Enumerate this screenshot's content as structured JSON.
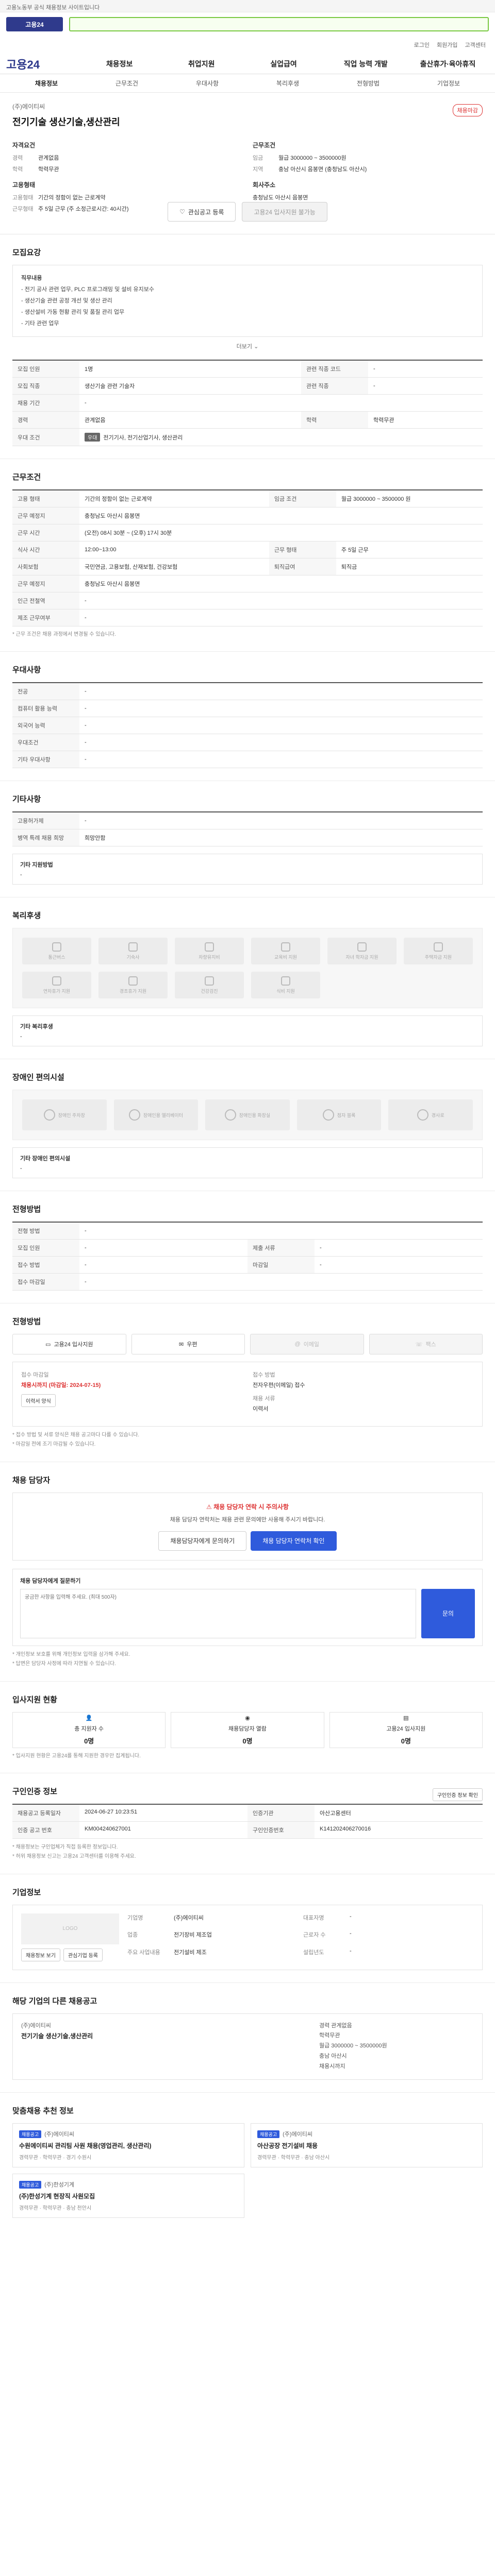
{
  "top_banner": "고용노동부 공식 채용정보 사이트입니다",
  "util": [
    "로그인",
    "회원가입",
    "고객센터"
  ],
  "gnb": {
    "brand": "고용24",
    "menu": [
      "채용정보",
      "취업지원",
      "실업급여",
      "직업 능력 개발",
      "출산휴가·육아휴직"
    ]
  },
  "subnav": [
    "채용정보",
    "근무조건",
    "우대사항",
    "복리후생",
    "전형방법",
    "기업정보"
  ],
  "job": {
    "company": "(주)에이티씨",
    "title": "전기기술 생산기술,생산관리",
    "badge": "채용마감",
    "summary_left_title": "자격요건",
    "summary_right_title": "근무조건",
    "left": [
      {
        "k": "경력",
        "v": "관계없음"
      },
      {
        "k": "학력",
        "v": "학력무관"
      }
    ],
    "left2_title": "고용형태",
    "left2": [
      {
        "k": "고용형태",
        "v": "기간의 정함이 없는 근로계약"
      },
      {
        "k": "근무형태",
        "v": "주 5일 근무 (주 소정근로시간: 40시간)"
      }
    ],
    "right": [
      {
        "k": "임금",
        "v": "월급 3000000 ~ 3500000원"
      },
      {
        "k": "지역",
        "v": "충남 아산시 음봉면 (충청남도 아산시)"
      }
    ],
    "right2_title": "회사주소",
    "right2_value": "충청남도 아산시 음봉면"
  },
  "actions": {
    "like": "관심공고 등록",
    "apply": "고용24 입사지원 불가능"
  },
  "duty": {
    "title": "모집요강",
    "desc_lines": [
      "직무내용",
      "- 전기 공사 관련 업무, PLC 프로그래밍 및 설비 유지보수",
      "- 생산기술 관련 공정 개선 및 생산 관리",
      "- 생산설비 가동 현황 관리 및 품질 관리 업무",
      "- 기타 관련 업무"
    ],
    "more": "더보기"
  },
  "conditions": {
    "rows": [
      {
        "k": "모집 인원",
        "v": "1명",
        "k2": "관련 직종 코드",
        "v2": "-"
      },
      {
        "k": "모집 직종",
        "v": "생산기술 관련 기술자",
        "k2": "관련 직종",
        "v2": "-"
      },
      {
        "k": "채용 기간",
        "v": "-",
        "k2": "",
        "v2": ""
      },
      {
        "k": "경력",
        "v": "관계없음",
        "k2": "학력",
        "v2": "학력무관"
      },
      {
        "k": "우대 조건",
        "v": "전기기사, 전기산업기사, 생산관리",
        "k2": "",
        "v2": ""
      }
    ],
    "tag": "우대"
  },
  "work": {
    "title": "근무조건",
    "rows": [
      {
        "k": "고용 형태",
        "v": "기간의 정함이 없는 근로계약",
        "k2": "임금 조건",
        "v2": "월급 3000000 ~ 3500000 원"
      },
      {
        "k": "근무 예정지",
        "v": "충청남도 아산시 음봉면",
        "k2": "",
        "v2": ""
      },
      {
        "k": "근무 시간",
        "v": "(오전) 08시 30분 ~ (오후) 17시 30분",
        "k2": "",
        "v2": ""
      },
      {
        "k": "식사 시간",
        "v": "12:00~13:00",
        "k2": "근무 형태",
        "v2": "주 5일 근무"
      },
      {
        "k": "사회보험",
        "v": "국민연금, 고용보험, 산재보험, 건강보험",
        "k2": "퇴직급여",
        "v2": "퇴직금"
      },
      {
        "k": "근무 예정지",
        "v": "충청남도 아산시 음봉면",
        "k2": "",
        "v2": ""
      },
      {
        "k": "인근 전철역",
        "v": "-",
        "k2": "",
        "v2": ""
      },
      {
        "k": "제조 근무여부",
        "v": "-",
        "k2": "",
        "v2": ""
      }
    ],
    "note": "* 근무 조건은 채용 과정에서 변경될 수 있습니다."
  },
  "pref": {
    "title": "우대사항",
    "rows": [
      {
        "k": "전공",
        "v": "-"
      },
      {
        "k": "컴퓨터 활용 능력",
        "v": "-"
      },
      {
        "k": "외국어 능력",
        "v": "-"
      },
      {
        "k": "우대조건",
        "v": "-"
      },
      {
        "k": "기타 우대사항",
        "v": "-"
      }
    ]
  },
  "extra": {
    "title": "기타사항",
    "rows": [
      {
        "k": "고용허가제",
        "v": "-"
      },
      {
        "k": "병역 특례 채용 희망",
        "v": "희망안함"
      }
    ],
    "etc_title": "기타 지원방법",
    "etc_value": "-"
  },
  "welfare": {
    "title": "복리후생",
    "items": [
      "통근버스",
      "기숙사",
      "차량유지비",
      "교육비 지원",
      "자녀 학자금 지원",
      "주택자금 지원",
      "연차휴가 지원",
      "경조휴가 지원",
      "건강검진",
      "식비 지원"
    ],
    "etc_title": "기타 복리후생",
    "etc_value": "-"
  },
  "disab": {
    "title": "장애인 편의시설",
    "items": [
      "장애인 주차장",
      "장애인용 엘리베이터",
      "장애인용 화장실",
      "점자 블록",
      "경사로"
    ],
    "etc_title": "기타 장애인 편의시설",
    "etc_value": "-"
  },
  "screening": {
    "title": "전형방법",
    "rows": [
      {
        "k": "전형 방법",
        "v": "-"
      },
      {
        "k": "모집 인원",
        "v": "-",
        "k2": "제출 서류",
        "v2": "-"
      },
      {
        "k": "접수 방법",
        "v": "-",
        "k2": "마감일",
        "v2": "-"
      },
      {
        "k": "접수 마감일",
        "v": "-",
        "k2": "",
        "v2": ""
      }
    ]
  },
  "apply": {
    "title": "전형방법",
    "methods": [
      "고용24 입사지원",
      "우편",
      "이메일",
      "팩스"
    ],
    "col1_lbl": "접수 마감일",
    "col1_val": "채용시까지 (마감일: 2024-07-15)",
    "col1_btn": "이력서 양식",
    "col2_lbl": "접수 방법",
    "col2_val": "전자우편(이메일) 접수",
    "col2_lbl2": "채용 서류",
    "col2_val2": "이력서",
    "notes": [
      "* 접수 방법 및 서류 양식은 채용 공고마다 다를 수 있습니다.",
      "* 마감일 전에 조기 마감될 수 있습니다."
    ]
  },
  "contact": {
    "title": "채용 담당자",
    "alert": "채용 담당자 연락 시 주의사항",
    "desc": "채용 담당자 연락처는 채용 관련 문의에만 사용해 주시기 바랍니다.",
    "btn1": "채용담당자에게 문의하기",
    "btn2": "채용 담당자 연락처 확인",
    "inq_label": "채용 담당자에게 질문하기",
    "inq_placeholder": "궁금한 사항을 입력해 주세요. (최대 500자)",
    "inq_submit": "문의",
    "inq_notes": [
      "* 개인정보 보호를 위해 개인정보 입력을 삼가해 주세요.",
      "* 답변은 담당자 사정에 따라 지연될 수 있습니다."
    ]
  },
  "stats": {
    "title": "입사지원 현황",
    "cards": [
      {
        "label": "총 지원자 수",
        "num": "0명"
      },
      {
        "label": "채용담당자 열람",
        "num": "0명"
      },
      {
        "label": "고용24 입사지원",
        "num": "0명"
      }
    ],
    "note": "* 입사지원 현황은 고용24를 통해 지원한 경우만 집계됩니다."
  },
  "reg": {
    "title": "구인인증 정보",
    "rows": [
      {
        "k": "채용공고 등록일자",
        "v": "2024-06-27 10:23:51",
        "k2": "인증기관",
        "v2": "아산고용센터"
      },
      {
        "k": "인증 공고 번호",
        "v": "KM004240627001",
        "k2": "구인인증번호",
        "v2": "K141202406270016"
      }
    ],
    "btn": "구인인증 정보 확인",
    "notes": [
      "* 채용정보는 구인업체가 직접 등록한 정보입니다.",
      "* 허위 채용정보 신고는 고용24 고객센터를 이용해 주세요."
    ]
  },
  "company": {
    "title": "기업정보",
    "logo_text": "LOGO",
    "btn1": "채용정보 보기",
    "btn2": "관심기업 등록",
    "rows": [
      {
        "k": "기업명",
        "v": "(주)에이티씨",
        "k2": "대표자명",
        "v2": "-"
      },
      {
        "k": "업종",
        "v": "전기장비 제조업",
        "k2": "근로자 수",
        "v2": "-"
      },
      {
        "k": "주요 사업내용",
        "v": "전기설비 제조",
        "k2": "설립년도",
        "v2": "-"
      }
    ]
  },
  "related": {
    "title": "해당 기업의 다른 채용공고",
    "company": "(주)에이티씨",
    "job": "전기기술 생산기술,생산관리",
    "meta": [
      "경력 관계없음",
      "학력무관",
      "월급 3000000 ~ 3500000원",
      "충남 아산시",
      "채용시까지"
    ]
  },
  "recommend": {
    "title": "맞춤채용 추천 정보",
    "cards": [
      {
        "badge": "채용공고",
        "co": "(주)에이티씨",
        "t": "수원에이티씨 관리팀 사원 채용(영업관리, 생산관리)",
        "meta": "경력무관 · 학력무관 · 경기 수원시"
      },
      {
        "badge": "채용공고",
        "co": "(주)에이티씨",
        "t": "아산공장 전기설비 채용",
        "meta": "경력무관 · 학력무관 · 충남 아산시"
      },
      {
        "badge": "채용공고",
        "co": "(주)한성기계",
        "t": "(주)한성기계 현장직 사원모집",
        "meta": "경력무관 · 학력무관 · 충남 천안시"
      }
    ]
  }
}
